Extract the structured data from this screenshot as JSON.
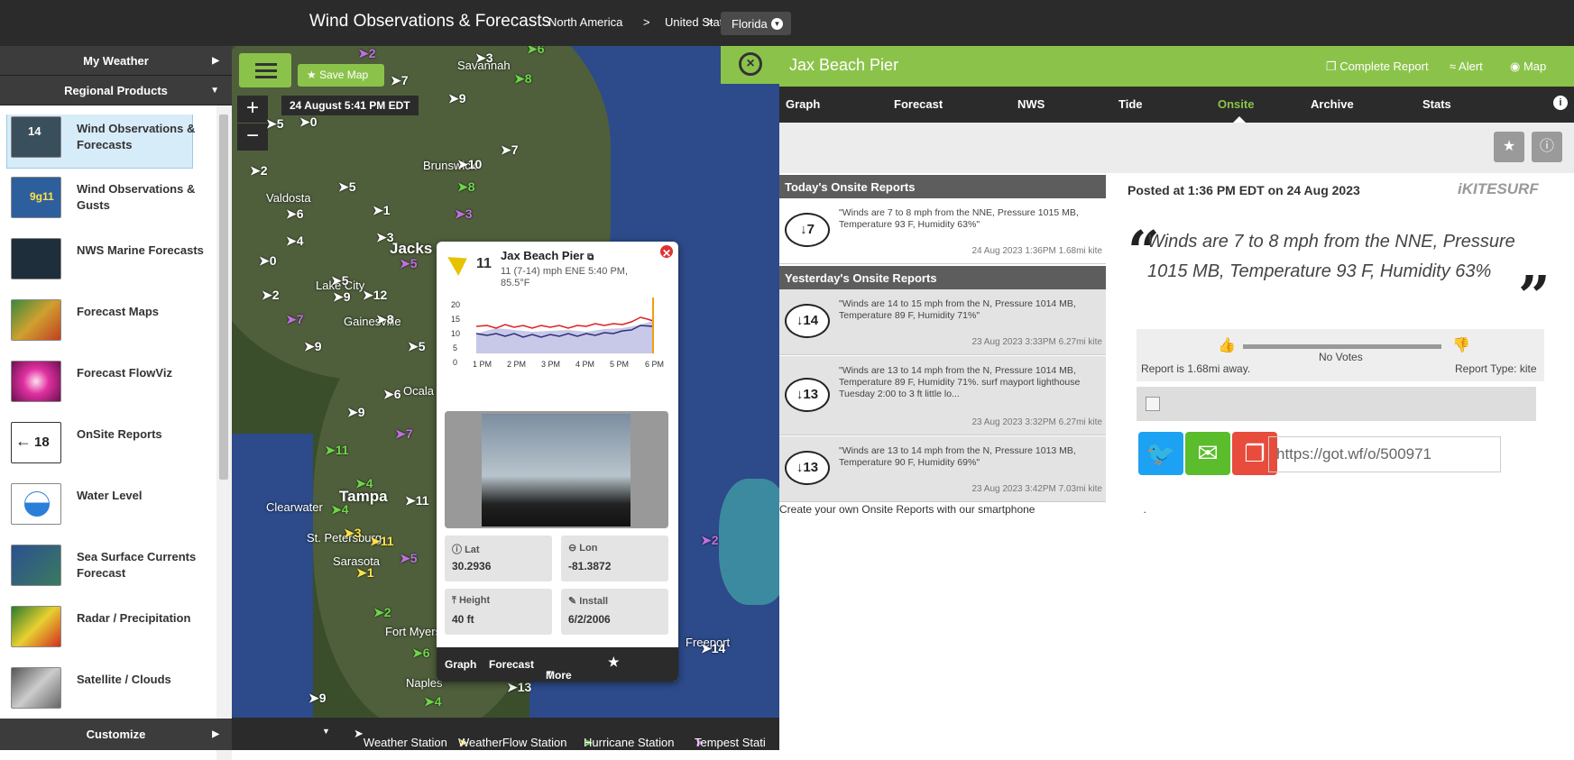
{
  "topbar": {
    "title": "Wind Observations & Forecasts",
    "crumb1": "North America",
    "sep1": ">",
    "crumb2": "United States",
    "sep2": ">",
    "state": "Florida"
  },
  "sidebar": {
    "my_weather": "My Weather",
    "regional_products": "Regional Products",
    "customize": "Customize",
    "items": [
      {
        "label": "Wind Observations & Forecasts",
        "thumb_color": "#3a4f5c"
      },
      {
        "label": "Wind Observations & Gusts",
        "thumb_color": "#2d5f9c"
      },
      {
        "label": "NWS Marine Forecasts",
        "thumb_color": "#1e2e3a"
      },
      {
        "label": "Forecast Maps",
        "thumb_color": "#b86a36"
      },
      {
        "label": "Forecast FlowViz",
        "thumb_color": "#c0309a"
      },
      {
        "label": "OnSite Reports",
        "thumb_color": "#ffffff"
      },
      {
        "label": "Water Level",
        "thumb_color": "#2c7fd8"
      },
      {
        "label": "Sea Surface Currents Forecast",
        "thumb_color": "#2b5090"
      },
      {
        "label": "Radar / Precipitation",
        "thumb_color": "#48a03a"
      },
      {
        "label": "Satellite / Clouds",
        "thumb_color": "#777777"
      }
    ],
    "onsite_badge": "18",
    "wind_badge_1": "14",
    "wind_badge_2": "9g11"
  },
  "map": {
    "save_map": "Save Map",
    "date_chip": "24 August 5:41 PM EDT",
    "zoom_in": "+",
    "zoom_out": "−",
    "cities": [
      "Savannah",
      "Brunswick",
      "Valdosta",
      "Jacks",
      "Lake City",
      "Gainesville",
      "Ocala",
      "Tampa",
      "Clearwater",
      "St. Petersburg",
      "Sarasota",
      "Fort Myers",
      "Naples",
      "Freeport"
    ],
    "markers": [
      "2",
      "6",
      "3",
      "8",
      "9",
      "7",
      "5",
      "0",
      "10",
      "7",
      "8",
      "2",
      "6",
      "5",
      "1",
      "3",
      "3",
      "4",
      "5",
      "0",
      "2",
      "5",
      "8",
      "9",
      "7",
      "9",
      "12",
      "11",
      "6",
      "4",
      "9",
      "7",
      "4",
      "11",
      "3",
      "11",
      "5",
      "1",
      "2",
      "6",
      "2",
      "4",
      "13",
      "9",
      "14",
      "2",
      "5"
    ]
  },
  "popup": {
    "title": "Jax Beach Pier",
    "wind": "11",
    "detail": "11 (7-14) mph ENE 5:40 PM, 85.5°F",
    "y_ticks": [
      "20",
      "15",
      "10",
      "5",
      "0"
    ],
    "x_ticks": [
      "1 PM",
      "2 PM",
      "3 PM",
      "4 PM",
      "5 PM",
      "6 PM"
    ],
    "lat_label": "Lat",
    "lat": "30.2936",
    "lon_label": "Lon",
    "lon": "-81.3872",
    "height_label": "Height",
    "height": "40 ft",
    "install_label": "Install",
    "install": "6/2/2006",
    "foot_graph": "Graph",
    "foot_forecast": "Forecast",
    "foot_more": "More"
  },
  "legend": {
    "weather_station": "Weather Station",
    "weatherflow_station": "WeatherFlow Station",
    "hurricane_station": "Hurricane Station",
    "tempest_station": "Tempest Stati"
  },
  "panel": {
    "name": "Jax Beach Pier",
    "complete_report": "Complete Report",
    "alert": "Alert",
    "map": "Map",
    "tabs": [
      "Graph",
      "Forecast",
      "NWS",
      "Tide",
      "Onsite",
      "Archive",
      "Stats"
    ],
    "today_header": "Today's Onsite Reports",
    "yesterday_header": "Yesterday's Onsite Reports",
    "reports": [
      {
        "badge": "7",
        "text": "\"Winds are 7 to 8 mph from the NNE, Pressure 1015 MB, Temperature 93 F, Humidity 63%\"",
        "meta": "24 Aug 2023 1:36PM   1.68mi   kite"
      },
      {
        "badge": "14",
        "text": "\"Winds are 14 to 15 mph from the N, Pressure 1014 MB, Temperature 89 F, Humidity 71%\"",
        "meta": "23 Aug 2023 3:33PM   6.27mi   kite"
      },
      {
        "badge": "13",
        "text": "\"Winds are 13 to 14 mph from the N, Pressure 1014 MB, Temperature 89 F, Humidity 71%. surf mayport lighthouse Tuesday 2:00 to 3 ft little lo...",
        "meta": "23 Aug 2023 3:32PM   6.27mi   kite"
      },
      {
        "badge": "13",
        "text": "\"Winds are 13 to 14 mph from the N, Pressure 1013 MB, Temperature 90 F, Humidity 69%\"",
        "meta": "23 Aug 2023 3:42PM   7.03mi   kite"
      }
    ],
    "create_text": "Create your own Onsite Reports with our smartphone",
    "create_end": ".",
    "posted": "Posted at 1:36 PM EDT on 24 Aug 2023",
    "brand": "iKITESURF",
    "quote": "Winds are 7 to 8 mph from the NNE, Pressure 1015 MB, Temperature 93 F, Humidity 63%",
    "no_votes": "No Votes",
    "distance": "Report is 1.68mi away.",
    "report_type": "Report Type: kite",
    "url": "https://got.wf/o/500971"
  }
}
